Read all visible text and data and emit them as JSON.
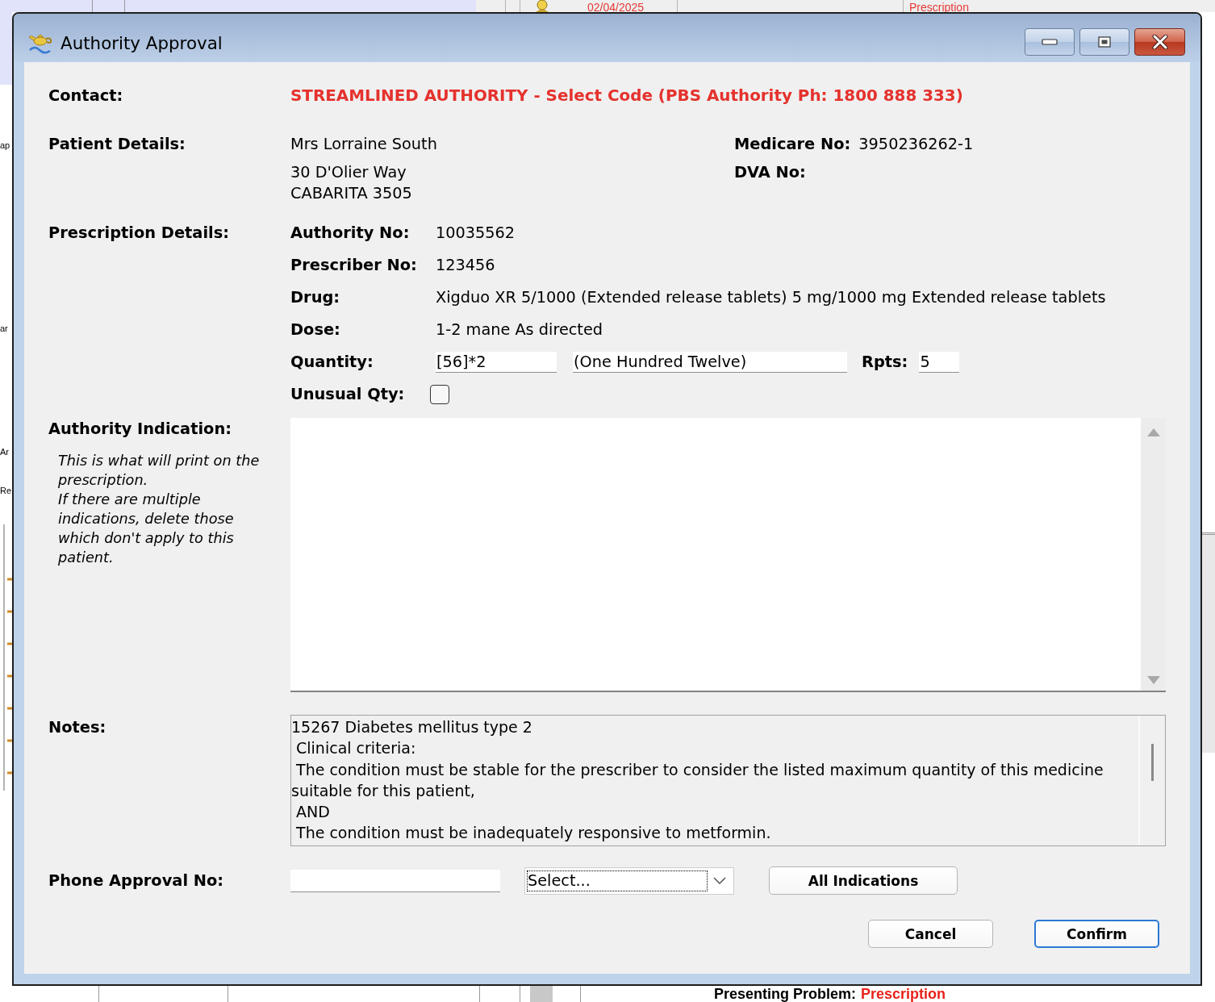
{
  "background": {
    "table_row": {
      "date": "02/04/2025",
      "entry": "Prescription"
    },
    "row_labels": [
      "ap",
      "ar",
      "Ar",
      "Re"
    ],
    "heading": {
      "label": "Presenting Problem:",
      "value": "Prescription"
    }
  },
  "window": {
    "title": "Authority Approval"
  },
  "contact": {
    "label": "Contact:",
    "value": "STREAMLINED AUTHORITY - Select Code (PBS Authority Ph: 1800 888 333)"
  },
  "patient": {
    "label": "Patient Details:",
    "name": "Mrs Lorraine South",
    "address": [
      "30 D'Olier Way",
      "CABARITA 3505"
    ],
    "ids": [
      {
        "label": "Medicare No:",
        "value": "3950236262-1"
      },
      {
        "label": "DVA No:"
      }
    ]
  },
  "prescription": {
    "label": "Prescription Details:",
    "fields": [
      {
        "label": "Authority No:",
        "value": "10035562"
      },
      {
        "label": "Prescriber No:",
        "value": "123456"
      },
      {
        "label": "Drug:",
        "value": "Xigduo XR 5/1000 (Extended release tablets) 5 mg/1000 mg Extended release tablets"
      },
      {
        "label": "Dose:",
        "value": "1-2 mane As directed"
      }
    ],
    "quantity": {
      "label": "Quantity:",
      "value": "[56]*2",
      "words": "(One Hundred Twelve)"
    },
    "repeats": {
      "label": "Rpts:",
      "value": "5"
    },
    "unusual_qty": {
      "label": "Unusual Qty:",
      "checked": false
    }
  },
  "indication": {
    "label": "Authority Indication:",
    "help": [
      "This is what will print on the prescription.",
      "If there are multiple indications, delete those which don't apply to this patient."
    ]
  },
  "notes": {
    "label": "Notes:",
    "text": "15267 Diabetes mellitus type 2\n Clinical criteria:\n The condition must be stable for the prescriber to consider the listed maximum quantity of this medicine suitable for this patient,\n AND\n The condition must be inadequately responsive to metformin."
  },
  "phone_approval": {
    "label": "Phone Approval No:",
    "select": {
      "value": "Select...",
      "focused": true
    },
    "button": {
      "label": "All Indications"
    }
  },
  "footer_buttons": [
    {
      "label": "Cancel",
      "default": false
    },
    {
      "label": "Confirm",
      "default": true
    }
  ]
}
